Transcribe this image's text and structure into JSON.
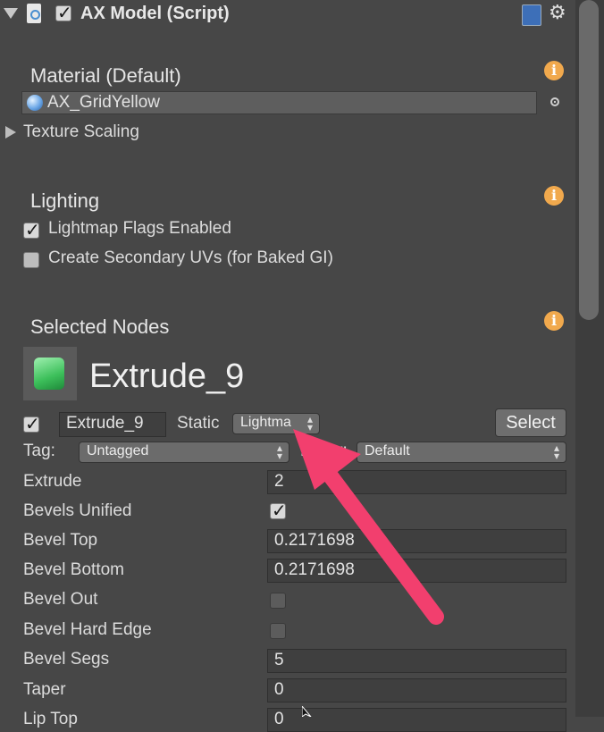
{
  "header": {
    "title": "AX Model (Script)",
    "enabled": true
  },
  "material_section": {
    "title": "Material (Default)",
    "material_value": "AX_GridYellow",
    "texture_scaling_label": "Texture Scaling"
  },
  "lighting_section": {
    "title": "Lighting",
    "lightmap_flags_label": "Lightmap Flags Enabled",
    "lightmap_flags_checked": true,
    "secondary_uvs_label": "Create Secondary UVs (for Baked GI)",
    "secondary_uvs_checked": false
  },
  "selected_nodes": {
    "title": "Selected Nodes",
    "node_name": "Extrude_9",
    "name_field_value": "Extrude_9",
    "static_label": "Static",
    "static_dropdown_value": "Lightma",
    "select_button_label": "Select",
    "tag_label": "Tag:",
    "tag_value": "Untagged",
    "layer_label": "Layer:",
    "layer_value": "Default"
  },
  "properties": [
    {
      "label": "Extrude",
      "type": "text",
      "value": "2"
    },
    {
      "label": "Bevels Unified",
      "type": "checkbox",
      "checked": true
    },
    {
      "label": "Bevel Top",
      "type": "text",
      "value": "0.2171698"
    },
    {
      "label": "Bevel Bottom",
      "type": "text",
      "value": "0.2171698"
    },
    {
      "label": "Bevel Out",
      "type": "checkbox",
      "checked": false
    },
    {
      "label": "Bevel Hard Edge",
      "type": "checkbox",
      "checked": false
    },
    {
      "label": "Bevel Segs",
      "type": "text",
      "value": "5"
    },
    {
      "label": "Taper",
      "type": "text",
      "value": "0"
    },
    {
      "label": "Lip Top",
      "type": "text",
      "value": "0"
    }
  ],
  "icons": {
    "info": "i",
    "gear": "⚙"
  },
  "colors": {
    "background": "#474747",
    "info_icon": "#f1a94d",
    "annotation_arrow": "#f23f6e"
  }
}
